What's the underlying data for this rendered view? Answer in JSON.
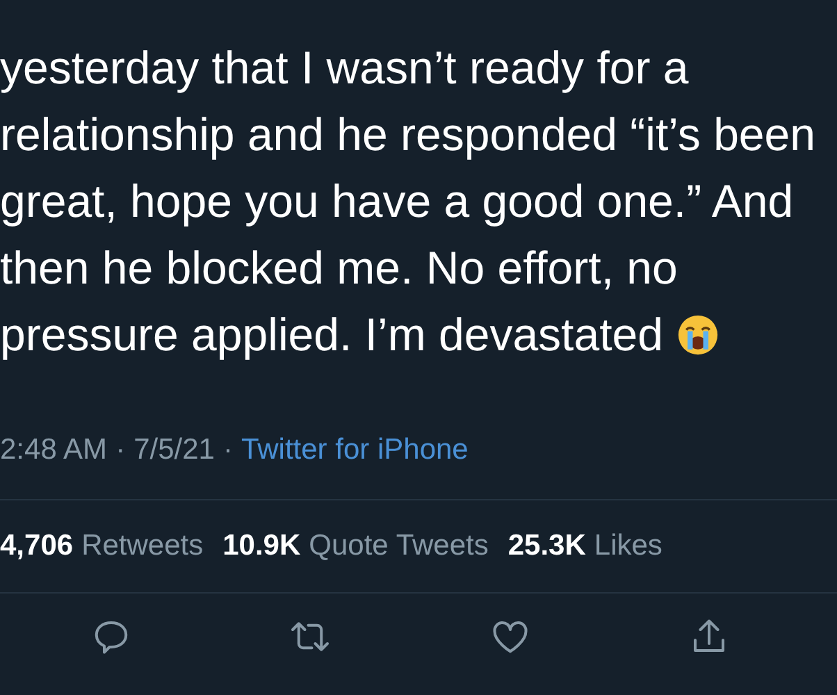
{
  "tweet": {
    "text_lines": [
      "yesterday that I wasn’t ready for a",
      "relationship and he responded “it’s been",
      "great, hope you have a good one.” And",
      "then he blocked me. No effort, no"
    ],
    "last_line": "pressure applied. I’m devastated",
    "meta": {
      "time": "2:48 AM",
      "separator": "·",
      "date": "7/5/21",
      "source": "Twitter for iPhone"
    },
    "stats": [
      {
        "count": "4,706",
        "label": "Retweets"
      },
      {
        "count": "10.9K",
        "label": "Quote Tweets"
      },
      {
        "count": "25.3K",
        "label": "Likes"
      }
    ],
    "actions": [
      {
        "kind": "reply"
      },
      {
        "kind": "retweet"
      },
      {
        "kind": "like"
      },
      {
        "kind": "share"
      }
    ]
  }
}
